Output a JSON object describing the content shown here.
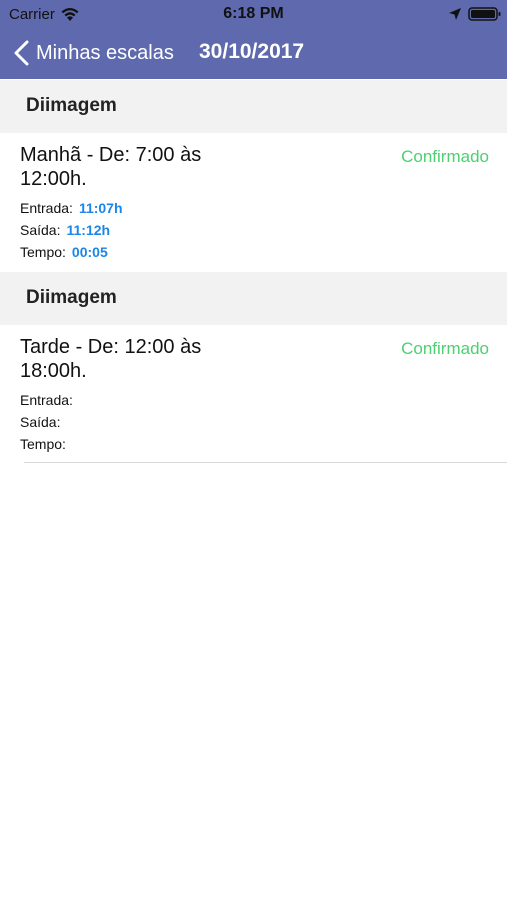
{
  "status_bar": {
    "carrier": "Carrier",
    "time": "6:18 PM",
    "icons": [
      "wifi-icon",
      "location-arrow-icon",
      "battery-icon"
    ]
  },
  "nav": {
    "back_label": "Minhas escalas",
    "title": "30/10/2017",
    "back_icon": "chevron-left-icon"
  },
  "colors": {
    "nav_background": "#5f6aae",
    "section_background": "#f2f2f2",
    "status_confirmed": "#4cd070",
    "time_value": "#1a86e8"
  },
  "shifts": [
    {
      "section": "Diimagem",
      "title": "Manhã - De: 7:00 às 12:00h.",
      "status": "Confirmado",
      "entrada_label": "Entrada:",
      "entrada_value": "11:07h",
      "saida_label": "Saída:",
      "saida_value": "11:12h",
      "tempo_label": "Tempo:",
      "tempo_value": "00:05"
    },
    {
      "section": "Diimagem",
      "title": "Tarde - De: 12:00 às 18:00h.",
      "status": "Confirmado",
      "entrada_label": "Entrada:",
      "entrada_value": "",
      "saida_label": "Saída:",
      "saida_value": "",
      "tempo_label": "Tempo:",
      "tempo_value": ""
    }
  ]
}
